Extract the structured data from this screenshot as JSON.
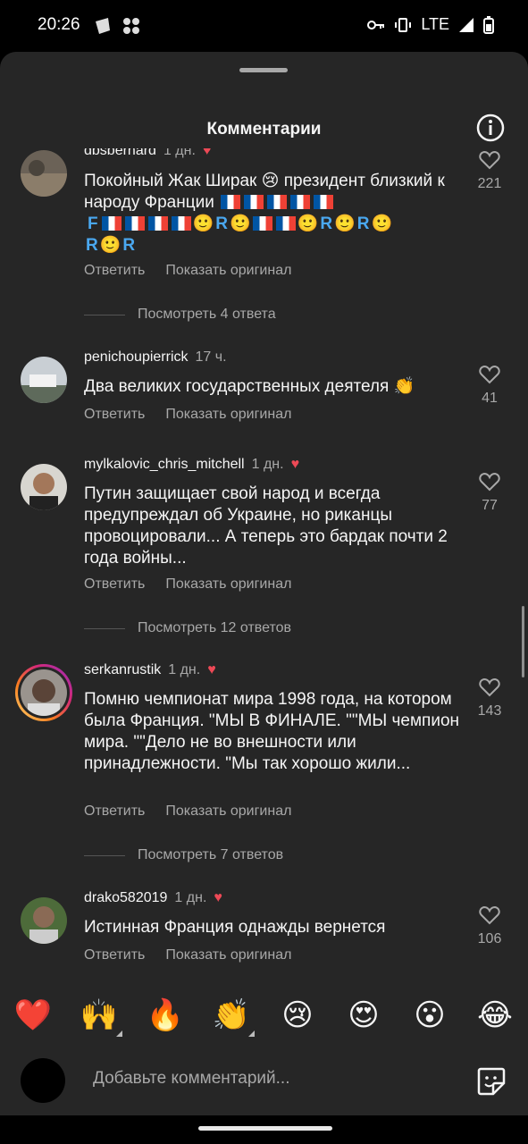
{
  "status": {
    "time": "20:26",
    "network": "LTE"
  },
  "sheet": {
    "title": "Комментарии"
  },
  "comments": [
    {
      "username": "dbsbernard",
      "time": "1 дн.",
      "text": "Покойный Жак Ширак 😢 президент близкий к народу Франции",
      "likes": "221",
      "reply": "Ответить",
      "translate": "Показать оригинал",
      "view_replies": "Посмотреть 4 ответа"
    },
    {
      "username": "penichoupierrick",
      "time": "17 ч.",
      "text": "Два великих государственных деятеля 👏",
      "likes": "41",
      "reply": "Ответить",
      "translate": "Показать оригинал"
    },
    {
      "username": "mylkalovic_chris_mitchell",
      "time": "1 дн.",
      "text": "Путин защищает свой народ и всегда предупреждал об Украине, но риканцы провоцировали... А теперь это бардак почти 2 года войны...",
      "likes": "77",
      "reply": "Ответить",
      "translate": "Показать оригинал",
      "view_replies": "Посмотреть 12 ответов"
    },
    {
      "username": "serkanrustik",
      "time": "1 дн.",
      "text": "Помню чемпионат мира 1998 года, на котором была Франция. \"МЫ В ФИНАЛЕ. \"\"МЫ чемпион мира. \"\"Дело не во внешности или принадлежности. \"Мы так хорошо жили...",
      "likes": "143",
      "reply": "Ответить",
      "translate": "Показать оригинал",
      "view_replies": "Посмотреть 7 ответов"
    },
    {
      "username": "drako582019",
      "time": "1 дн.",
      "text": "Истинная Франция однажды вернется",
      "likes": "106",
      "reply": "Ответить",
      "translate": "Показать оригинал"
    }
  ],
  "emoji_bar": [
    "❤️",
    "🙌",
    "🔥",
    "👏",
    "😢",
    "😍",
    "😮",
    "😂"
  ],
  "composer": {
    "placeholder": "Добавьте комментарий..."
  },
  "colors": {
    "sheet_bg": "#262626",
    "text_primary": "#f5f5f5",
    "text_secondary": "#a8a8a8",
    "like_red": "#ed4956"
  }
}
